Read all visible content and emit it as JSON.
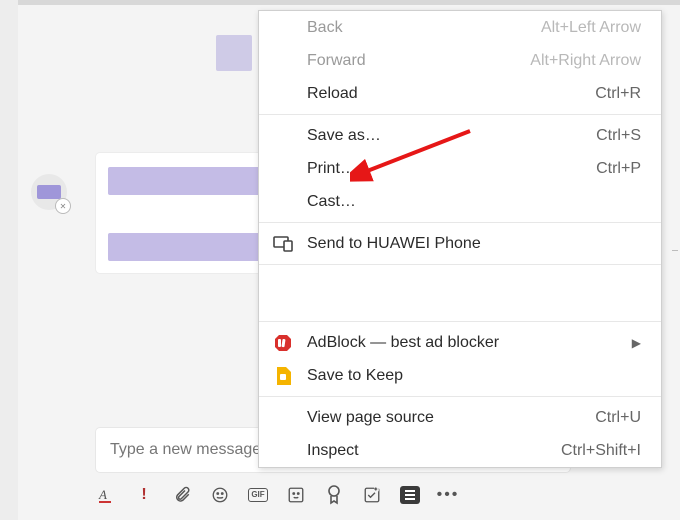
{
  "compose": {
    "placeholder": "Type a new message"
  },
  "menu": {
    "back": {
      "label": "Back",
      "shortcut": "Alt+Left Arrow"
    },
    "forward": {
      "label": "Forward",
      "shortcut": "Alt+Right Arrow"
    },
    "reload": {
      "label": "Reload",
      "shortcut": "Ctrl+R"
    },
    "saveas": {
      "label": "Save as…",
      "shortcut": "Ctrl+S"
    },
    "print": {
      "label": "Print…",
      "shortcut": "Ctrl+P"
    },
    "cast": {
      "label": "Cast…"
    },
    "sendto": {
      "label": "Send to HUAWEI Phone"
    },
    "adblock": {
      "label": "AdBlock — best ad blocker"
    },
    "keep": {
      "label": "Save to Keep"
    },
    "viewsource": {
      "label": "View page source",
      "shortcut": "Ctrl+U"
    },
    "inspect": {
      "label": "Inspect",
      "shortcut": "Ctrl+Shift+I"
    }
  },
  "annotation": {
    "points_to": "print"
  },
  "toolbar": {
    "gif": "GIF"
  }
}
